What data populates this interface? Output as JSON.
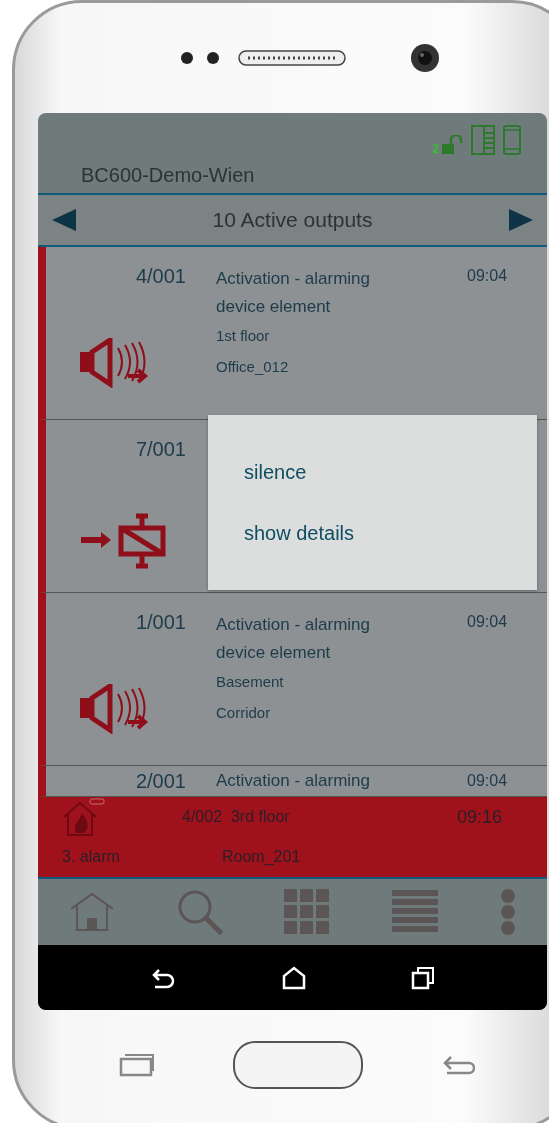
{
  "screen": {
    "title": "BC600-Demo-Wien",
    "lock_badge": "2"
  },
  "nav": {
    "label": "10 Active outputs"
  },
  "outputs": [
    {
      "kind": "sounder",
      "number": "4/001",
      "description": "Activation - alarming device element",
      "floor": "1st floor",
      "room": "Office_012",
      "time": "09:04"
    },
    {
      "kind": "actuator",
      "number": "7/001"
    },
    {
      "kind": "sounder",
      "number": "1/001",
      "description": "Activation - alarming device element",
      "floor": "Basement",
      "room": "Corridor",
      "time": "09:04"
    },
    {
      "kind": "partial",
      "number": "2/001",
      "description": "Activation - alarming",
      "time": "09:04"
    }
  ],
  "context_menu": [
    "silence",
    "show details"
  ],
  "alarm_bar": {
    "number": "4/002",
    "floor": "3rd floor",
    "time": "09:16",
    "label": "3. alarm",
    "room": "Room_201"
  }
}
